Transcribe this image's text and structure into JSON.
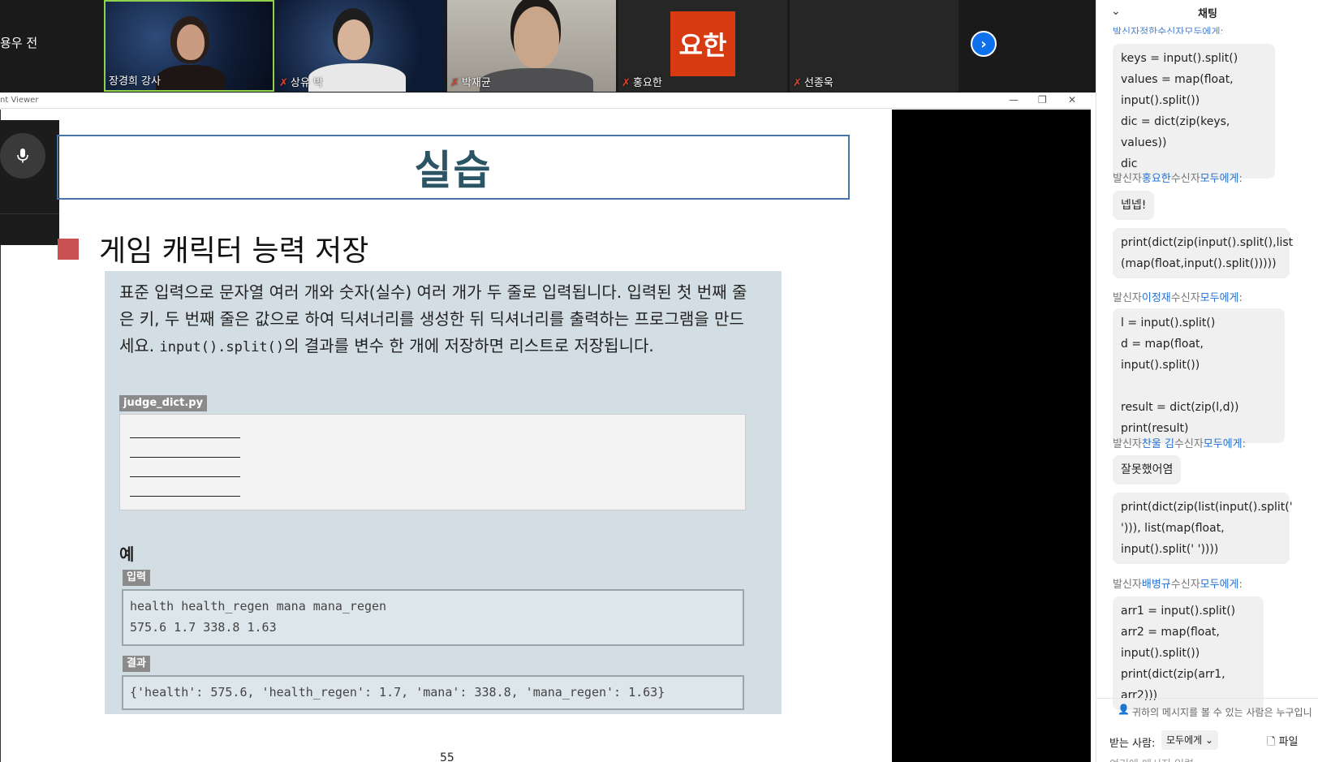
{
  "strip": {
    "left_name": "용우 전",
    "tiles": [
      {
        "name": "장경희 강사"
      },
      {
        "name": "상유 박"
      },
      {
        "name": "박재균"
      },
      {
        "name": "홍요한"
      },
      {
        "name": "선종욱"
      }
    ],
    "avatar_text": "요한",
    "next_symbol": "›"
  },
  "viewer": {
    "title": "nt Viewer",
    "min": "—",
    "restore": "❐",
    "close": "✕"
  },
  "slide": {
    "title": "실습",
    "heading": "게임 캐릭터 능력 저장",
    "desc_1": "표준 입력으로 문자열 여러 개와 숫자(실수) 여러 개가 두 줄로 입력됩니다. 입력된 첫 번째 줄은 키, 두 번째 줄은 값으로 하여 딕셔너리를 생성한 뒤 딕셔너리를 출력하는 프로그램을 만드세요.",
    "desc_code": "input().split()",
    "desc_2": "의 결과를 변수 한 개에 저장하면 리스트로 저장됩니다.",
    "file_tag": "judge_dict.py",
    "example_label": "예",
    "input_tag": "입력",
    "input_line1": "health health_regen mana mana_regen",
    "input_line2": "575.6 1.7 338.8 1.63",
    "result_tag": "결과",
    "result_line": "{'health': 575.6, 'health_regen': 1.7, 'mana': 338.8, 'mana_regen': 1.63}",
    "page_number": "55"
  },
  "chat": {
    "title": "채팅",
    "partial_top": "발신자정한수신자모두에게:",
    "messages": [
      {
        "lines": [
          "keys = input().split()",
          "values = map(float,",
          "input().split())",
          "dic = dict(zip(keys, values))",
          "dic"
        ]
      },
      {
        "sender_prefix": "발신자",
        "sender": "홍요한",
        "mid": "수신자",
        "to": "모두에게",
        "colon": ":"
      },
      {
        "lines": [
          "넵넵!"
        ]
      },
      {
        "lines": [
          "print(dict(zip(input().split(),list",
          "(map(float,input().split()))))"
        ]
      },
      {
        "sender_prefix": "발신자",
        "sender": "이정재",
        "mid": "수신자",
        "to": "모두에게",
        "colon": ":"
      },
      {
        "lines": [
          "l = input().split()",
          "d = map(float, input().split())",
          "",
          "result = dict(zip(l,d))",
          "print(result)"
        ]
      },
      {
        "sender_prefix": "발신자",
        "sender": "찬울 김",
        "mid": "수신자",
        "to": "모두에게",
        "colon": ":"
      },
      {
        "lines": [
          "잘못했어염"
        ]
      },
      {
        "lines": [
          "print(dict(zip(list(input().split('",
          "'))), list(map(float,",
          "input().split(' '))))"
        ]
      },
      {
        "sender_prefix": "발신자",
        "sender": "배병규",
        "mid": "수신자",
        "to": "모두에게",
        "colon": ":"
      },
      {
        "lines": [
          "arr1 = input().split()",
          "arr2 = map(float,",
          "input().split())",
          "print(dict(zip(arr1, arr2)))"
        ]
      }
    ],
    "visibility_note": "귀하의 메시지를 볼 수 있는 사람은 누구입니",
    "to_label": "받는 사람:",
    "to_value": "모두에게",
    "file_label": "파일",
    "input_placeholder": "여기에 메시지 입력..."
  }
}
